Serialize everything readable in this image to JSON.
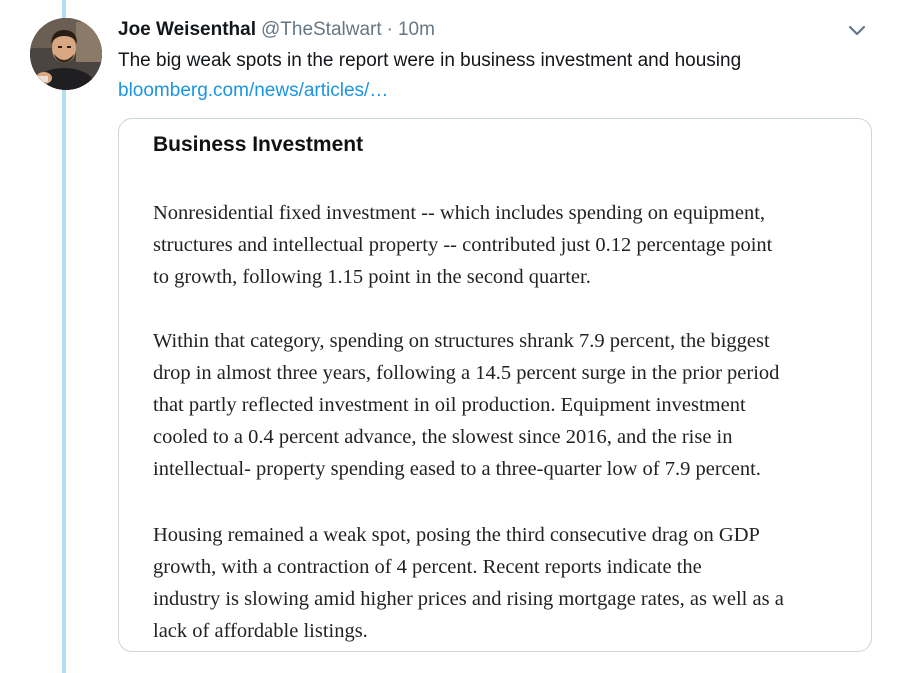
{
  "tweet": {
    "author": {
      "display_name": "Joe Weisenthal",
      "handle": "@TheStalwart",
      "avatar_icon": "user-avatar-photo"
    },
    "separator": "·",
    "time": "10m",
    "menu_icon": "chevron-down-icon",
    "text": "The big weak spots in the report were in business investment and housing",
    "link": "bloomberg.com/news/articles/…",
    "thread_line_color": "#b3ddf5",
    "link_color": "#1b95e0"
  },
  "card": {
    "heading": "Business Investment",
    "paragraphs": [
      {
        "lines": [
          "Nonresidential fixed investment -- which includes spending on equipment,",
          "structures and intellectual property -- contributed just 0.12 percentage point",
          "to growth, following 1.15 point in the second quarter."
        ]
      },
      {
        "lines": [
          "Within that category, spending on structures shrank 7.9 percent, the biggest",
          "drop in almost three years, following a 14.5 percent surge in the prior period",
          "that partly reflected investment in oil production. Equipment investment",
          "cooled to a 0.4 percent advance, the slowest since 2016, and the rise in",
          "intellectual- property spending eased to a three-quarter low of 7.9 percent."
        ]
      },
      {
        "lines": [
          "Housing remained a weak spot, posing the third consecutive drag on GDP",
          "growth, with a contraction of 4 percent. Recent reports indicate the",
          "industry is slowing amid higher prices and rising mortgage rates, as well as a",
          "lack of affordable listings."
        ]
      }
    ]
  }
}
